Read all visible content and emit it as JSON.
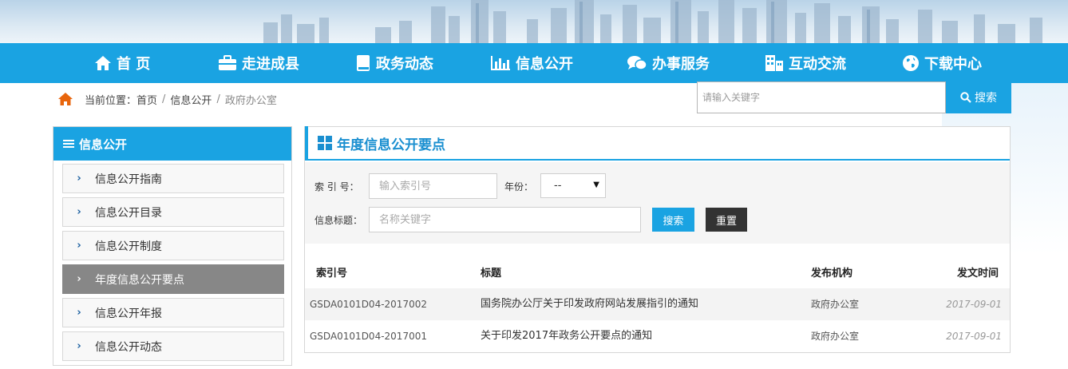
{
  "nav": {
    "items": [
      {
        "label": "首 页",
        "icon": "home-icon"
      },
      {
        "label": "走进成县",
        "icon": "briefcase-icon"
      },
      {
        "label": "政务动态",
        "icon": "book-icon"
      },
      {
        "label": "信息公开",
        "icon": "bar-chart-icon"
      },
      {
        "label": "办事服务",
        "icon": "chat-bubbles-icon"
      },
      {
        "label": "互动交流",
        "icon": "building-icon"
      },
      {
        "label": "下载中心",
        "icon": "globe-icon"
      }
    ]
  },
  "breadcrumb": {
    "prefix": "当前位置：",
    "home": "首页",
    "level1": "信息公开",
    "current": "政府办公室",
    "separator": "/"
  },
  "search": {
    "placeholder": "请输入关键字",
    "button_label": "搜索"
  },
  "sidebar": {
    "title": "信息公开",
    "items": [
      {
        "label": "信息公开指南"
      },
      {
        "label": "信息公开目录"
      },
      {
        "label": "信息公开制度"
      },
      {
        "label": "年度信息公开要点"
      },
      {
        "label": "信息公开年报"
      },
      {
        "label": "信息公开动态"
      }
    ],
    "active_index": 3
  },
  "panel": {
    "title": "年度信息公开要点",
    "filter": {
      "index_label": "索 引 号：",
      "index_placeholder": "输入索引号",
      "year_label": "年份：",
      "year_value": "--",
      "title_label": "信息标题：",
      "title_placeholder": "名称关键字",
      "search_button": "搜索",
      "reset_button": "重置"
    },
    "table": {
      "headers": [
        "索引号",
        "标题",
        "发布机构",
        "发文时间"
      ],
      "rows": [
        {
          "index": "GSDA0101D04-2017002",
          "title": "国务院办公厅关于印发政府网站发展指引的通知",
          "org": "政府办公室",
          "date": "2017-09-01"
        },
        {
          "index": "GSDA0101D04-2017001",
          "title": "关于印发2017年政务公开要点的通知",
          "org": "政府办公室",
          "date": "2017-09-01"
        }
      ]
    }
  },
  "colors": {
    "primary": "#1aa3e2",
    "active_item": "#878787",
    "dark_button": "#333333",
    "home_icon": "#e8650c"
  }
}
